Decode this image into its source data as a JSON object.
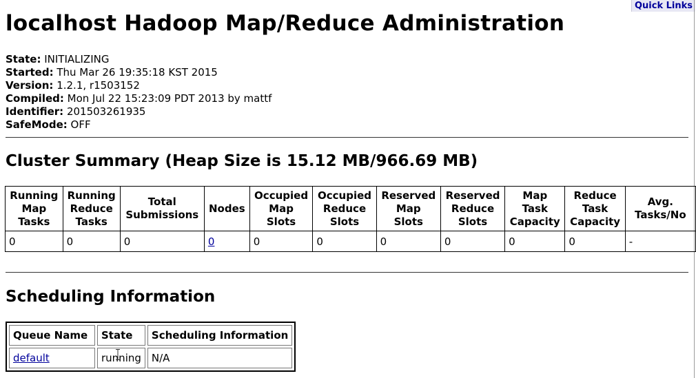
{
  "quick_links": "Quick Links",
  "title": "localhost Hadoop Map/Reduce Administration",
  "info": [
    {
      "label": "State:",
      "value": "INITIALIZING"
    },
    {
      "label": "Started:",
      "value": "Thu Mar 26 19:35:18 KST 2015"
    },
    {
      "label": "Version:",
      "value": "1.2.1, r1503152"
    },
    {
      "label": "Compiled:",
      "value": "Mon Jul 22 15:23:09 PDT 2013 by mattf"
    },
    {
      "label": "Identifier:",
      "value": "201503261935"
    },
    {
      "label": "SafeMode:",
      "value": "OFF"
    }
  ],
  "cluster_summary": {
    "heading": "Cluster Summary (Heap Size is 15.12 MB/966.69 MB)",
    "headers": [
      [
        "Running",
        "Map",
        "Tasks"
      ],
      [
        "Running",
        "Reduce",
        "Tasks"
      ],
      [
        "Total",
        "Submissions"
      ],
      [
        "Nodes"
      ],
      [
        "Occupied",
        "Map",
        "Slots"
      ],
      [
        "Occupied",
        "Reduce",
        "Slots"
      ],
      [
        "Reserved",
        "Map",
        "Slots"
      ],
      [
        "Reserved",
        "Reduce",
        "Slots"
      ],
      [
        "Map",
        "Task",
        "Capacity"
      ],
      [
        "Reduce",
        "Task",
        "Capacity"
      ],
      [
        "Avg.",
        "Tasks/No"
      ]
    ],
    "values": [
      "0",
      "0",
      "0",
      "0",
      "0",
      "0",
      "0",
      "0",
      "0",
      "0",
      "-"
    ]
  },
  "scheduling": {
    "heading": "Scheduling Information",
    "headers": [
      "Queue Name",
      "State",
      "Scheduling Information"
    ],
    "rows": [
      {
        "queue": "default",
        "state": "running",
        "info": "N/A"
      }
    ]
  },
  "colors": {
    "link": "#00009b",
    "quick_links_bg": "#e8e8f4"
  }
}
